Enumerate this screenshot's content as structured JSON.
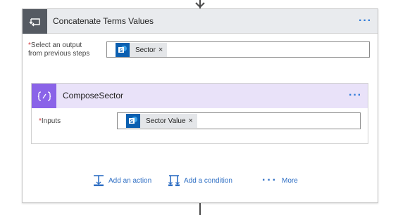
{
  "outer_scope": {
    "title": "Concatenate Terms Values",
    "more": "···",
    "output_field": {
      "required_mark": "*",
      "label_line1": "Select an output",
      "label_line2": "from previous steps",
      "token_label": "Sector",
      "token_remove": "×"
    }
  },
  "inner_action": {
    "title": "ComposeSector",
    "more": "···",
    "inputs_field": {
      "required_mark": "*",
      "label": "Inputs",
      "token_label": "Sector Value",
      "token_remove": "×"
    }
  },
  "footer_actions": {
    "add_action": "Add an action",
    "add_condition": "Add a condition",
    "more_dots": "···",
    "more": "More"
  },
  "colors": {
    "accent_blue": "#2f7bd9",
    "loop_icon_bg": "#555a62",
    "compose_icon_bg": "#8a63e8",
    "compose_header_bg": "#e9e2f9",
    "sharepoint_blue": "#0b5fb0",
    "required_red": "#d13438"
  }
}
